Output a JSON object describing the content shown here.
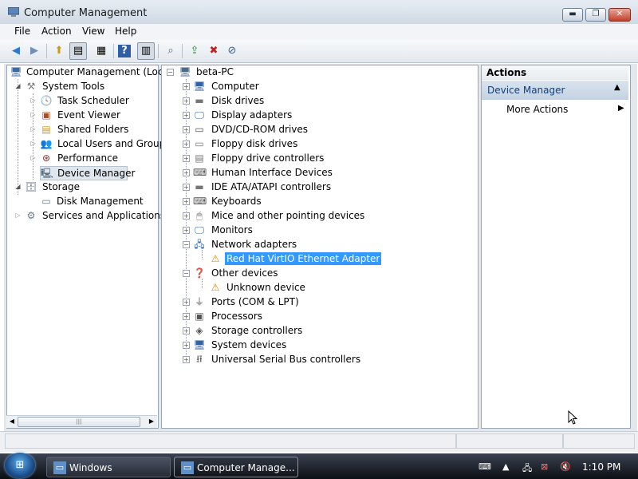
{
  "window": {
    "title": "Computer Management"
  },
  "title_buttons": {
    "minimize": "▬",
    "maximize": "❐",
    "close": "✕"
  },
  "menu": [
    "File",
    "Action",
    "View",
    "Help"
  ],
  "toolbar": {
    "icons": [
      "back-icon",
      "forward-icon",
      "up-icon",
      "show-hide-console-tree-icon",
      "properties-icon",
      "help-icon",
      "show-hide-action-pane-icon",
      "scan-hardware-icon",
      "update-driver-icon",
      "disable-device-icon",
      "uninstall-device-icon"
    ]
  },
  "left_tree": [
    {
      "label": "Computer Management (Local",
      "icon": "computer-management-icon"
    },
    {
      "label": "System Tools",
      "icon": "system-tools-icon"
    },
    {
      "label": "Task Scheduler",
      "icon": "task-scheduler-icon"
    },
    {
      "label": "Event Viewer",
      "icon": "event-viewer-icon"
    },
    {
      "label": "Shared Folders",
      "icon": "shared-folders-icon"
    },
    {
      "label": "Local Users and Groups",
      "icon": "users-icon"
    },
    {
      "label": "Performance",
      "icon": "performance-icon"
    },
    {
      "label": "Device Manager",
      "icon": "device-manager-icon"
    },
    {
      "label": "Storage",
      "icon": "storage-icon"
    },
    {
      "label": "Disk Management",
      "icon": "disk-management-icon"
    },
    {
      "label": "Services and Applications",
      "icon": "services-icon"
    }
  ],
  "device_tree": {
    "root": "beta-PC",
    "categories": [
      "Computer",
      "Disk drives",
      "Display adapters",
      "DVD/CD-ROM drives",
      "Floppy disk drives",
      "Floppy drive controllers",
      "Human Interface Devices",
      "IDE ATA/ATAPI controllers",
      "Keyboards",
      "Mice and other pointing devices",
      "Monitors",
      "Network adapters",
      "Red Hat VirtIO Ethernet Adapter",
      "Other devices",
      "Unknown device",
      "Ports (COM & LPT)",
      "Processors",
      "Storage controllers",
      "System devices",
      "Universal Serial Bus controllers"
    ]
  },
  "actions": {
    "header": "Actions",
    "section": "Device Manager",
    "more": "More Actions"
  },
  "taskbar": {
    "start": "⊞",
    "tasks": [
      "Windows",
      "Computer Manage..."
    ],
    "clock": "1:10 PM"
  }
}
